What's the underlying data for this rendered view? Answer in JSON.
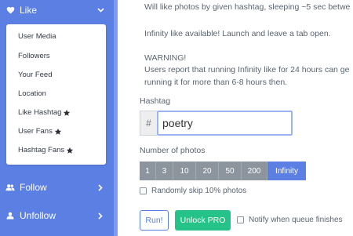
{
  "sidebar": {
    "like": {
      "label": "Like",
      "icon": "heart-icon"
    },
    "submenu": [
      {
        "label": "User Media",
        "star": false
      },
      {
        "label": "Followers",
        "star": false
      },
      {
        "label": "Your Feed",
        "star": false
      },
      {
        "label": "Location",
        "star": false
      },
      {
        "label": "Like Hashtag",
        "star": true
      },
      {
        "label": "User Fans",
        "star": true
      },
      {
        "label": "Hashtag Fans",
        "star": true
      }
    ],
    "follow": {
      "label": "Follow",
      "icon": "users-icon"
    },
    "unfollow": {
      "label": "Unfollow",
      "icon": "user-icon"
    }
  },
  "main": {
    "description": "Will like photos by given hashtag, sleeping ~5 sec betwe",
    "infinity_note": "Infinity like available! Launch and leave a tab open.",
    "warning_title": "WARNING!",
    "warning_line1": "Users report that running Infinity like for 24 hours can ge",
    "warning_line2": "running it for more than 6-8 hours then.",
    "hashtag_label": "Hashtag",
    "hash_prefix": "#",
    "hashtag_value": "poetry",
    "number_label": "Number of photos",
    "photo_counts": [
      "1",
      "3",
      "10",
      "20",
      "50",
      "200",
      "Infinity"
    ],
    "selected_count": "Infinity",
    "random_skip_label": "Randomly skip 10% photos",
    "run_label": "Run!",
    "unlock_label": "Unlock PRO",
    "notify_label": "Notify when queue finishes"
  },
  "colors": {
    "sidebar": "#5b7fe3",
    "accent": "#5b7fe3",
    "segment": "#8c959e",
    "pro": "#25c28a"
  }
}
